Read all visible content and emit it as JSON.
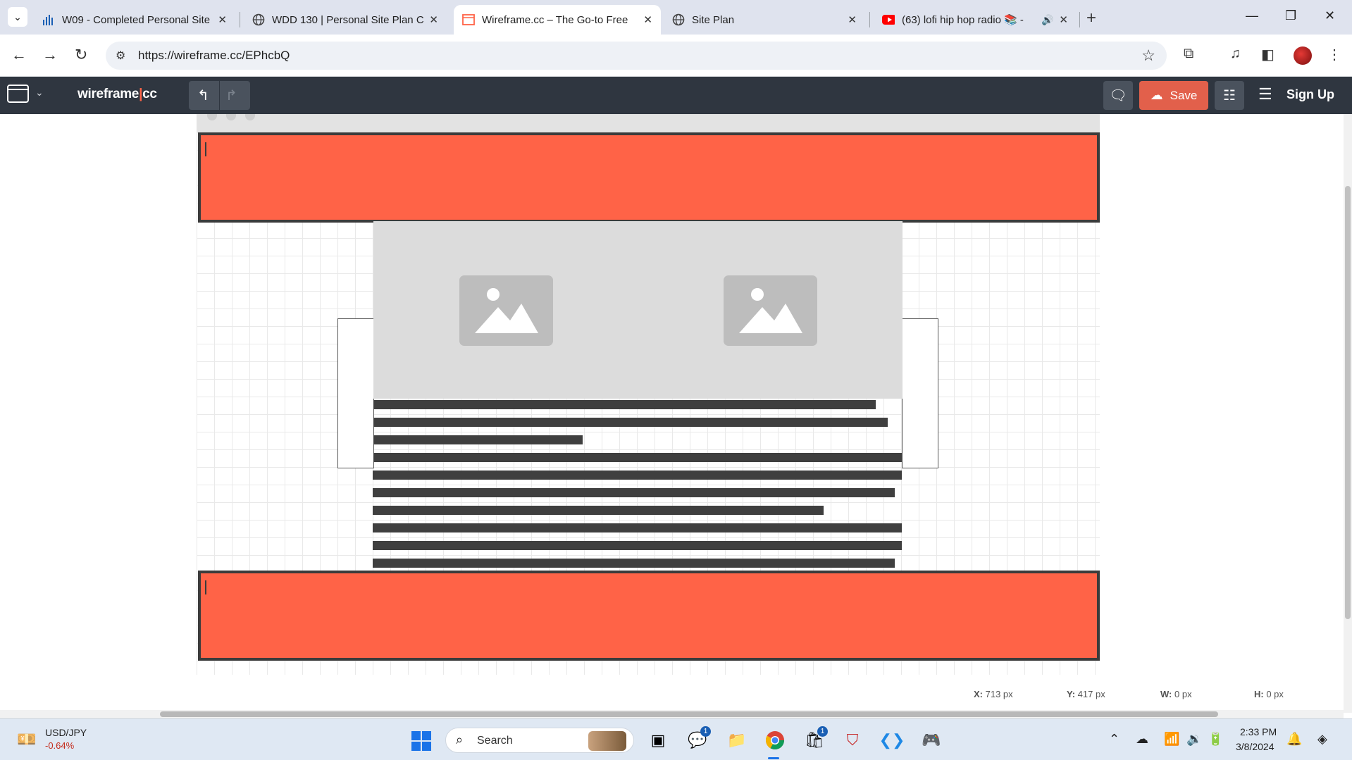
{
  "browser": {
    "tabs": [
      {
        "title": "W09 - Completed Personal Site",
        "favicon": "bar-chart-favicon"
      },
      {
        "title": "WDD 130 | Personal Site Plan C",
        "favicon": "globe-favicon"
      },
      {
        "title": "Wireframe.cc – The Go-to Free",
        "favicon": "wireframe-favicon",
        "active": true
      },
      {
        "title": "Site Plan",
        "favicon": "globe-favicon"
      },
      {
        "title": "(63) lofi hip hop radio 📚 -",
        "favicon": "youtube-favicon",
        "audio": true
      }
    ],
    "url": "https://wireframe.cc/EPhcbQ"
  },
  "app": {
    "brand_main": "wireframe",
    "brand_sep": "|",
    "brand_suffix": "cc",
    "save_label": "Save",
    "signup_label": "Sign Up"
  },
  "canvas": {
    "header_color": "#ff6347",
    "footer_color": "#ff6347",
    "hero_images": 2,
    "text_line_count": 10
  },
  "status": {
    "x_label": "X:",
    "x_value": "713 px",
    "y_label": "Y:",
    "y_value": "417 px",
    "w_label": "W:",
    "w_value": "0 px",
    "h_label": "H:",
    "h_value": "0 px"
  },
  "taskbar": {
    "ticker_name": "USD/JPY",
    "ticker_change": "-0.64%",
    "search_label": "Search",
    "time": "2:33 PM",
    "date": "3/8/2024",
    "teams_badge": "1",
    "store_badge": "1"
  },
  "colors": {
    "accent": "#ff6347",
    "appbar": "#2f3640",
    "save": "#e2604b"
  }
}
